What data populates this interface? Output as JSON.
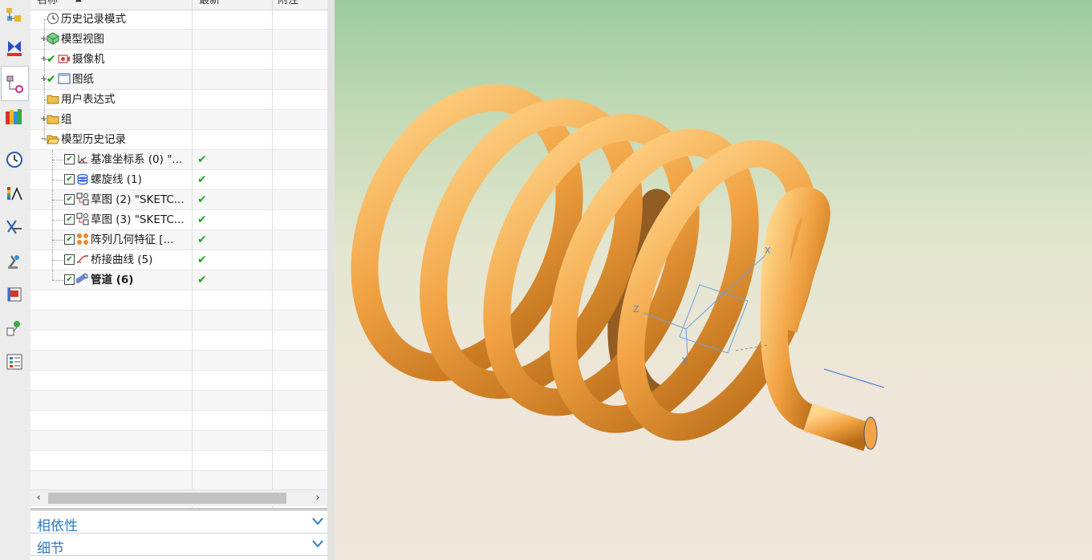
{
  "columns": {
    "name": "名称",
    "latest": "最新",
    "notes": "附注"
  },
  "tree": [
    {
      "label": "历史记录模式",
      "icon": "clock-icon",
      "expander": "",
      "check": false,
      "checkbox": false,
      "latest": ""
    },
    {
      "label": "模型视图",
      "icon": "model-view-icon",
      "expander": "+",
      "check": false,
      "checkbox": false,
      "latest": ""
    },
    {
      "label": "摄像机",
      "icon": "camera-icon",
      "expander": "+",
      "check": true,
      "checkbox": false,
      "latest": ""
    },
    {
      "label": "图纸",
      "icon": "drawing-sheet-icon",
      "expander": "+",
      "check": true,
      "checkbox": false,
      "latest": ""
    },
    {
      "label": "用户表达式",
      "icon": "folder-icon",
      "expander": "",
      "check": false,
      "checkbox": false,
      "latest": ""
    },
    {
      "label": "组",
      "icon": "folder-icon",
      "expander": "+",
      "check": false,
      "checkbox": false,
      "latest": ""
    },
    {
      "label": "模型历史记录",
      "icon": "folder-open-icon",
      "expander": "−",
      "check": false,
      "checkbox": false,
      "latest": ""
    },
    {
      "label": "基准坐标系 (0) \"...",
      "icon": "datum-csys-icon",
      "expander": "",
      "check": false,
      "checkbox": true,
      "latest": "✔"
    },
    {
      "label": "螺旋线 (1)",
      "icon": "helix-icon",
      "expander": "",
      "check": false,
      "checkbox": true,
      "latest": "✔"
    },
    {
      "label": "草图 (2) \"SKETC...",
      "icon": "sketch-icon",
      "expander": "",
      "check": false,
      "checkbox": true,
      "latest": "✔"
    },
    {
      "label": "草图 (3) \"SKETC...",
      "icon": "sketch-icon",
      "expander": "",
      "check": false,
      "checkbox": true,
      "latest": "✔"
    },
    {
      "label": "阵列几何特征 [...",
      "icon": "pattern-geometry-icon",
      "expander": "",
      "check": false,
      "checkbox": true,
      "latest": "✔"
    },
    {
      "label": "桥接曲线 (5)",
      "icon": "bridge-curve-icon",
      "expander": "",
      "check": false,
      "checkbox": true,
      "latest": "✔"
    },
    {
      "label": "管道 (6)",
      "icon": "tube-icon",
      "expander": "",
      "check": false,
      "checkbox": true,
      "latest": "✔",
      "bold": true
    }
  ],
  "sections": {
    "dependencies": "相依性",
    "details": "细节"
  },
  "axes": {
    "x": "X",
    "y": "Y",
    "z": "Z"
  },
  "colors": {
    "tube": "#f2a54a",
    "accent": "#2c7cc0",
    "ok": "#22a722"
  }
}
